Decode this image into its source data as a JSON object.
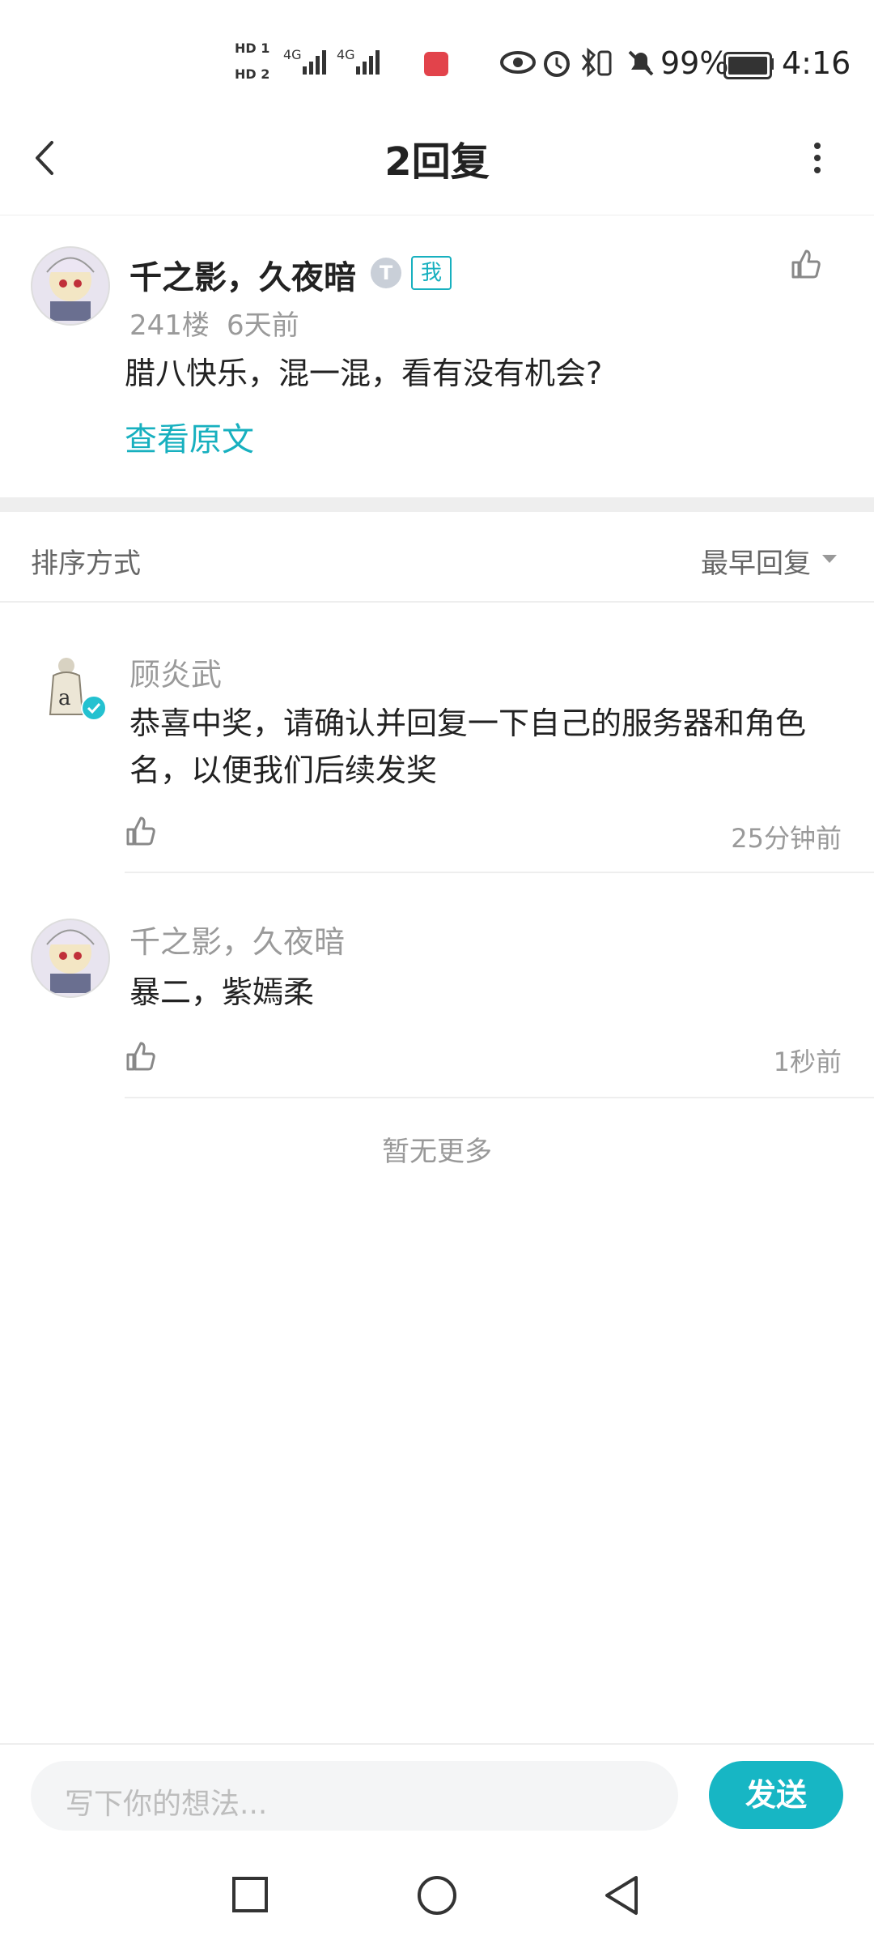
{
  "status_bar": {
    "hd1": "HD 1",
    "hd2": "HD 2",
    "net1": "4G",
    "net2": "4G",
    "battery": "99%",
    "time": "4:16"
  },
  "header": {
    "title": "2回复"
  },
  "original_post": {
    "author": "千之影，久夜暗",
    "badge_me": "我",
    "floor": "241楼",
    "time": "6天前",
    "content": "腊八快乐，混一混，看有没有机会?",
    "view_original": "查看原文"
  },
  "sort": {
    "label": "排序方式",
    "value": "最早回复"
  },
  "replies": [
    {
      "author": "顾炎武",
      "content": "恭喜中奖，请确认并回复一下自己的服务器和角色名，以便我们后续发奖",
      "time": "25分钟前"
    },
    {
      "author": "千之影，久夜暗",
      "content": "暴二，紫嫣柔",
      "time": "1秒前"
    }
  ],
  "footer_text": "暂无更多",
  "composer": {
    "placeholder": "写下你的想法...",
    "send_label": "发送"
  },
  "colors": {
    "accent": "#17b6c4",
    "link": "#17b0bf",
    "muted": "#9a9a9a"
  }
}
